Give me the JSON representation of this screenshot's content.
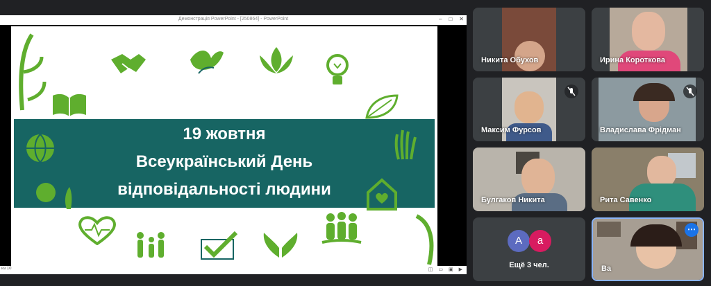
{
  "presentation": {
    "window_title": "Демонстрація PowerPoint - [250864] - PowerPoint",
    "slide_counter": "из 10",
    "slide": {
      "line1": "19 жовтня",
      "line2": "Всеукраїнський День",
      "line3": "відповідальності людини",
      "banner_color": "#176563",
      "icon_color": "#5fae2e"
    }
  },
  "participants": [
    {
      "name": "Никита Обухов",
      "muted": false
    },
    {
      "name": "Ирина Короткова",
      "muted": false
    },
    {
      "name": "Максим Фурсов",
      "muted": true
    },
    {
      "name": "Владислава Фрідман",
      "muted": true
    },
    {
      "name": "Булгаков Никита",
      "muted": false
    },
    {
      "name": "Рита Савенко",
      "muted": false
    }
  ],
  "more": {
    "avatars": [
      {
        "letter": "А",
        "color": "#5c6bc0"
      },
      {
        "letter": "а",
        "color": "#d81b60"
      }
    ],
    "label": "Ещё 3 чел."
  },
  "self_view": {
    "name": "Ва"
  }
}
